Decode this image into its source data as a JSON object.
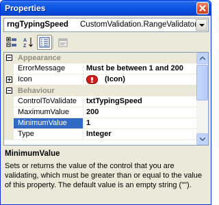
{
  "window": {
    "title": "Properties"
  },
  "object_selector": {
    "name": "rngTypingSpeed",
    "type": "CustomValidation.RangeValidator"
  },
  "toolbar": {
    "buttons": [
      {
        "icon": "categorized-icon",
        "active": false
      },
      {
        "icon": "alphabetical-icon",
        "active": false
      },
      {
        "icon": "properties-icon",
        "active": true
      },
      {
        "icon": "property-pages-icon",
        "active": false
      }
    ]
  },
  "grid": {
    "categories": [
      {
        "label": "Appearance"
      },
      {
        "label": "Behaviour"
      }
    ],
    "rows": [
      {
        "name": "ErrorMessage",
        "value": "Must be between 1 and 200"
      },
      {
        "name": "Icon",
        "value": "(Icon)"
      },
      {
        "name": "ControlToValidate",
        "value": "txtTypingSpeed"
      },
      {
        "name": "MaximumValue",
        "value": "200"
      },
      {
        "name": "MinimumValue",
        "value": "1"
      },
      {
        "name": "Type",
        "value": "Integer"
      }
    ],
    "selected_row": "MinimumValue"
  },
  "description": {
    "title": "MinimumValue",
    "text": "Sets or returns the value of the control that you are validating, which must be greater than or equal to the value of this property. The default value is an empty string (\"\")."
  },
  "colors": {
    "titlebar": "#0a54e3",
    "selection": "#316ac5",
    "category_text": "#938f84",
    "error_icon": "#d71b1b"
  }
}
